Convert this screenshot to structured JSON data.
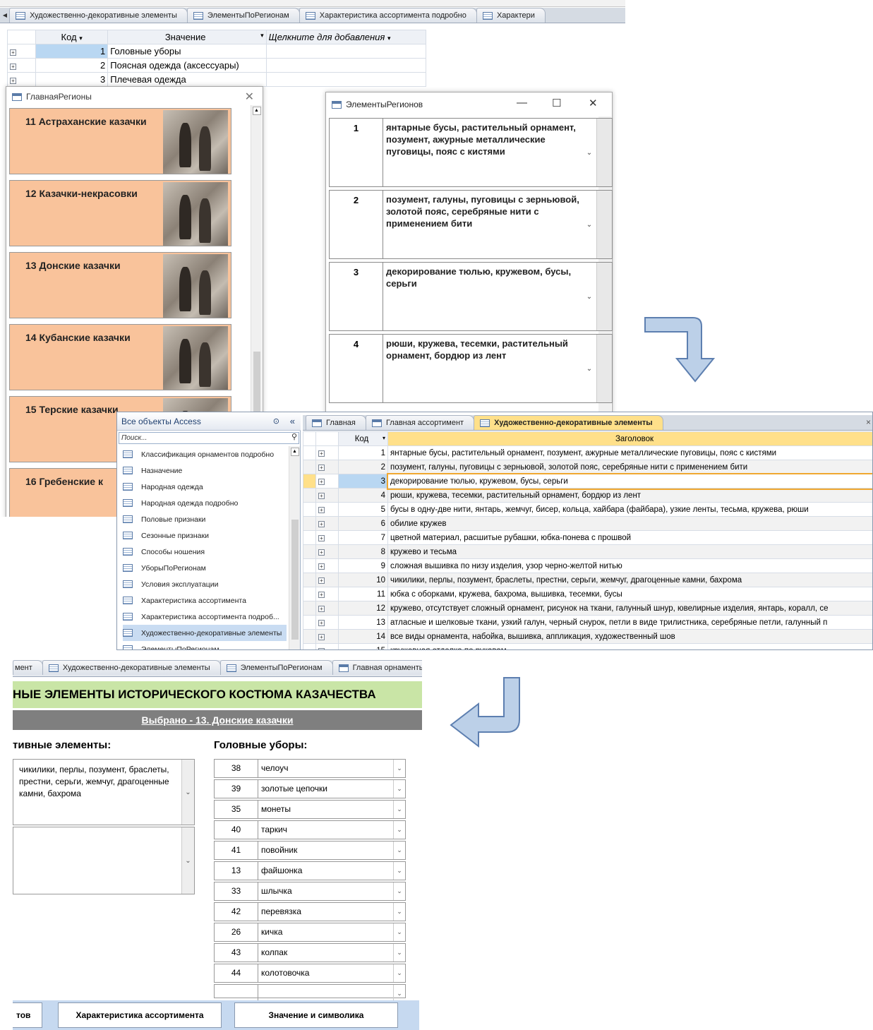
{
  "panel1": {
    "tabs": [
      "Художественно-декоративные элементы",
      "ЭлементыПоРегионам",
      "Характеристика ассортимента подробно",
      "Характери"
    ],
    "grid": {
      "headers": [
        "Код",
        "Значение",
        "Щелкните для добавления"
      ],
      "rows": [
        {
          "code": "1",
          "value": "Головные уборы"
        },
        {
          "code": "2",
          "value": "Поясная одежда (аксессуары)"
        },
        {
          "code": "3",
          "value": "Плечевая одежда"
        }
      ]
    },
    "regions_window": {
      "title": "ГлавнаяРегионы",
      "items": [
        {
          "name": "11 Астраханские казачки"
        },
        {
          "name": "12 Казачки-некрасовки"
        },
        {
          "name": "13 Донские казачки"
        },
        {
          "name": "14 Кубанские казачки"
        },
        {
          "name": "15 Терские казачки"
        },
        {
          "name": "16 Гребенские к"
        }
      ]
    },
    "elements_window": {
      "title": "ЭлементыРегионов",
      "min": "—",
      "max": "☐",
      "close": "✕",
      "rows": [
        {
          "num": "1",
          "text": "янтарные бусы, растительный орнамент, позумент, ажурные металлические пуговицы, пояс с кистями"
        },
        {
          "num": "2",
          "text": "позумент, галуны, пуговицы с зерньювой, золотой пояс, серебряные нити с применением бити"
        },
        {
          "num": "3",
          "text": "декорирование тюлью, кружевом, бусы, серьги"
        },
        {
          "num": "4",
          "text": "рюши, кружева, тесемки, растительный орнамент, бордюр из лент"
        }
      ]
    }
  },
  "panel2": {
    "nav": {
      "title": "Все объекты Access",
      "search": "Поиск...",
      "items": [
        "Классификация орнаментов подробно",
        "Назначение",
        "Народная одежда",
        "Народная одежда подробно",
        "Половые признаки",
        "Сезонные признаки",
        "Способы ношения",
        "УборыПоРегионам",
        "Условия эксплуатации",
        "Характеристика ассортимента",
        "Характеристика ассортимента подроб...",
        "Художественно-декоративные элементы",
        "ЭлементыПоРегионам"
      ],
      "selected_index": 11
    },
    "tabs": [
      "Главная",
      "Главная ассортимент",
      "Художественно-декоративные элементы"
    ],
    "grid": {
      "headers": [
        "Код",
        "Заголовок"
      ],
      "rows": [
        {
          "code": "1",
          "title": "янтарные бусы, растительный орнамент, позумент, ажурные металлические пуговицы, пояс с кистями"
        },
        {
          "code": "2",
          "title": "позумент, галуны, пуговицы с зерньювой, золотой пояс, серебряные нити с применением бити"
        },
        {
          "code": "3",
          "title": "декорирование тюлью, кружевом, бусы, серьги"
        },
        {
          "code": "4",
          "title": "рюши, кружева, тесемки, растительный орнамент, бордюр из лент"
        },
        {
          "code": "5",
          "title": "бусы в одну-две нити, янтарь, жемчуг, бисер, кольца, хайбара (файбара), узкие ленты, тесьма, кружева, рюши"
        },
        {
          "code": "6",
          "title": "обилие кружев"
        },
        {
          "code": "7",
          "title": "цветной материал, расшитые рубашки, юбка-понева с прошвой"
        },
        {
          "code": "8",
          "title": "кружево и тесьма"
        },
        {
          "code": "9",
          "title": "сложная вышивка по низу изделия, узор черно-желтой нитью"
        },
        {
          "code": "10",
          "title": "чикилики, перлы, позумент, браслеты, престни, серьги, жемчуг, драгоценные камни, бахрома"
        },
        {
          "code": "11",
          "title": "юбка с оборками, кружева, бахрома, вышивка, тесемки, бусы"
        },
        {
          "code": "12",
          "title": "кружево, отсутствует сложный орнамент, рисунок на ткани, галунный шнур, ювелирные изделия, янтарь, коралл, се"
        },
        {
          "code": "13",
          "title": "атласные и шелковые ткани, узкий галун, черный снурок, петли в виде трилистника, серебряные петли, галунный п"
        },
        {
          "code": "14",
          "title": "все виды орнамента, набойка, вышивка, аппликация, художественный шов"
        },
        {
          "code": "15",
          "title": "кружевная отделка по рукавам"
        }
      ],
      "selected_row": 2
    }
  },
  "panel3": {
    "tabs": [
      "мент",
      "Художественно-декоративные элементы",
      "ЭлементыПоРегионам",
      "Главная орнаменты"
    ],
    "banner": "НЫЕ ЭЛЕМЕНТЫ ИСТОРИЧЕСКОГО КОСТЮМА КАЗАЧЕСТВА",
    "selected": "Выбрано - 13. Донские казачки",
    "left_heading": "тивные элементы:",
    "left_text": "чикилики, перлы, позумент, браслеты, престни, серьги, жемчуг, драгоценные камни, бахрома",
    "right_heading": "Головные уборы:",
    "headwear": [
      {
        "num": "38",
        "name": "челоуч"
      },
      {
        "num": "39",
        "name": "золотые цепочки"
      },
      {
        "num": "35",
        "name": "монеты"
      },
      {
        "num": "40",
        "name": "таркич"
      },
      {
        "num": "41",
        "name": "повойник"
      },
      {
        "num": "13",
        "name": "файшонка"
      },
      {
        "num": "33",
        "name": "шлычка"
      },
      {
        "num": "42",
        "name": "перевязка"
      },
      {
        "num": "26",
        "name": "кичка"
      },
      {
        "num": "43",
        "name": "колпак"
      },
      {
        "num": "44",
        "name": "колотовочка"
      },
      {
        "num": "",
        "name": ""
      }
    ],
    "buttons": [
      "тов",
      "Характеристика ассортимента",
      "Значение и символика"
    ]
  },
  "colors": {
    "region_fill": "#f9c39b",
    "banner_green": "#c9e5a6",
    "selected_bar": "#7f7f7f",
    "arrow_fill": "#bcd0e8",
    "arrow_stroke": "#5d7fb0",
    "active_tab_orange": "#ffe08a"
  }
}
